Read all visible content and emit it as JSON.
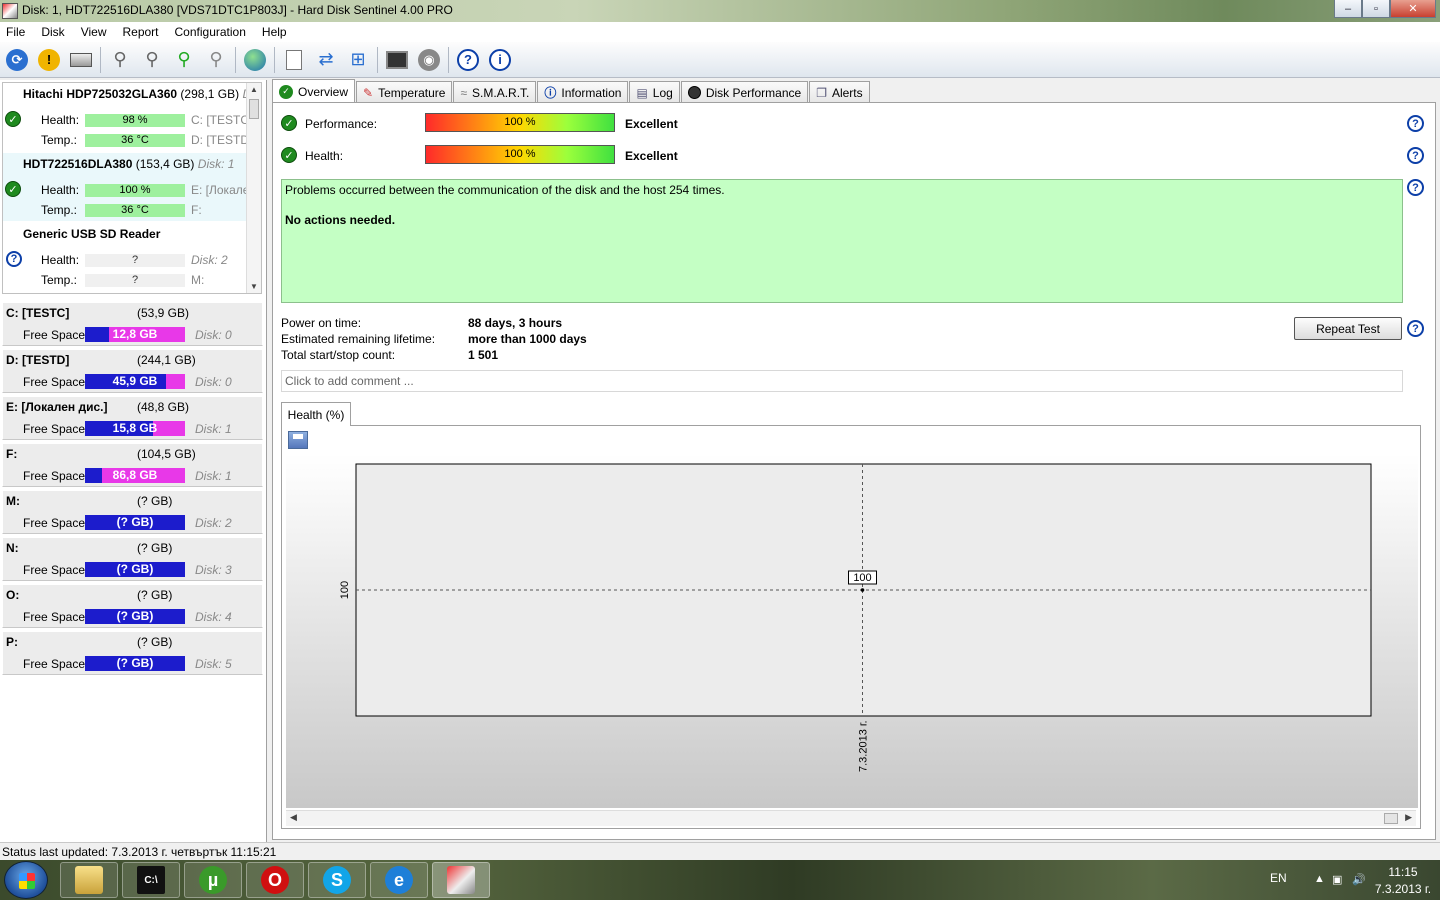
{
  "window": {
    "title": "Disk: 1, HDT722516DLA380 [VDS71DTC1P803J]  -  Hard Disk Sentinel 4.00 PRO",
    "min": "‒",
    "max": "▫",
    "close": "✕"
  },
  "menu": [
    "File",
    "Disk",
    "View",
    "Report",
    "Configuration",
    "Help"
  ],
  "toolbar": {
    "icons": [
      "refresh-icon",
      "alert-icon",
      "disk-icon",
      "network-disk-icon",
      "network-disk-2-icon",
      "network-disk-add-icon",
      "network-disk-remove-icon",
      "globe-icon",
      "report-icon",
      "sync-icon",
      "network-report-icon",
      "monitor-icon",
      "speaker-icon",
      "help-icon",
      "info-icon"
    ]
  },
  "disks": [
    {
      "name": "Hitachi HDP725032GLA360",
      "size": "(298,1 GB)",
      "disk": "D",
      "health_label": "Health:",
      "health": "98 %",
      "temp_label": "Temp.:",
      "temp": "36 °C",
      "side1": "C: [TESTC]",
      "side2": "D: [TESTD]",
      "status": "ok"
    },
    {
      "name": "HDT722516DLA380",
      "size": "(153,4 GB)",
      "disk": "Disk: 1",
      "health_label": "Health:",
      "health": "100 %",
      "temp_label": "Temp.:",
      "temp": "36 °C",
      "side1": "E: [Локале",
      "side2": "F:",
      "status": "ok"
    },
    {
      "name": "Generic USB SD Reader",
      "size": "",
      "disk": "",
      "health_label": "Health:",
      "health": "?",
      "temp_label": "Temp.:",
      "temp": "?",
      "side1": "Disk: 2",
      "side2": "M:",
      "status": "unknown"
    }
  ],
  "partitions": [
    {
      "name": "C: [TESTC]",
      "size": "(53,9 GB)",
      "free_label": "Free Space",
      "free": "12,8 GB",
      "fill": 0.24,
      "disk": "Disk: 0"
    },
    {
      "name": "D: [TESTD]",
      "size": "(244,1 GB)",
      "free_label": "Free Space",
      "free": "45,9 GB",
      "fill": 0.81,
      "disk": "Disk: 0"
    },
    {
      "name": "E: [Локален дис.]",
      "size": "(48,8 GB)",
      "free_label": "Free Space",
      "free": "15,8 GB",
      "fill": 0.68,
      "disk": "Disk: 1"
    },
    {
      "name": "F:",
      "size": "(104,5 GB)",
      "free_label": "Free Space",
      "free": "86,8 GB",
      "fill": 0.17,
      "disk": "Disk: 1"
    },
    {
      "name": "M:",
      "size": "(? GB)",
      "free_label": "Free Space",
      "free": "(? GB)",
      "fill": 1.0,
      "disk": "Disk: 2"
    },
    {
      "name": "N:",
      "size": "(? GB)",
      "free_label": "Free Space",
      "free": "(? GB)",
      "fill": 1.0,
      "disk": "Disk: 3"
    },
    {
      "name": "O:",
      "size": "(? GB)",
      "free_label": "Free Space",
      "free": "(? GB)",
      "fill": 1.0,
      "disk": "Disk: 4"
    },
    {
      "name": "P:",
      "size": "(? GB)",
      "free_label": "Free Space",
      "free": "(? GB)",
      "fill": 1.0,
      "disk": "Disk: 5"
    }
  ],
  "status_bar": "Status last updated: 7.3.2013 г. четвъртък 11:15:21",
  "tabs": [
    {
      "label": "Overview",
      "icon": "check-icon",
      "active": true
    },
    {
      "label": "Temperature",
      "icon": "thermometer-icon"
    },
    {
      "label": "S.M.A.R.T.",
      "icon": "smart-icon"
    },
    {
      "label": "Information",
      "icon": "info-icon"
    },
    {
      "label": "Log",
      "icon": "log-icon"
    },
    {
      "label": "Disk Performance",
      "icon": "performance-icon"
    },
    {
      "label": "Alerts",
      "icon": "alerts-icon"
    }
  ],
  "overview": {
    "performance_label": "Performance:",
    "performance_value": "100 %",
    "performance_rating": "Excellent",
    "health_label": "Health:",
    "health_value": "100 %",
    "health_rating": "Excellent",
    "message_line1": "Problems occurred between the communication of the disk and the host 254 times.",
    "message_line2": "No actions needed.",
    "power_on_label": "Power on time:",
    "power_on_value": "88 days, 3 hours",
    "lifetime_label": "Estimated remaining lifetime:",
    "lifetime_value": "more than 1000 days",
    "startstop_label": "Total start/stop count:",
    "startstop_value": "1 501",
    "repeat_test": "Repeat Test",
    "comment_placeholder": "Click to add comment ...",
    "chart_tab": "Health (%)"
  },
  "chart_data": {
    "type": "line",
    "x": [
      "7.3.2013 г."
    ],
    "series": [
      {
        "values": [
          100
        ]
      }
    ],
    "y_ticks": [
      "100"
    ],
    "data_labels": [
      "100"
    ],
    "grid": true,
    "colors": {
      "plot_bg": "#ececec",
      "point": "#000000"
    }
  },
  "taskbar": {
    "apps": [
      "explorer-icon",
      "console-icon",
      "utorrent-icon",
      "opera-icon",
      "skype-icon",
      "ie-icon",
      "hdsentinel-icon"
    ],
    "lang": "EN",
    "time": "11:15",
    "date": "7.3.2013 г."
  }
}
